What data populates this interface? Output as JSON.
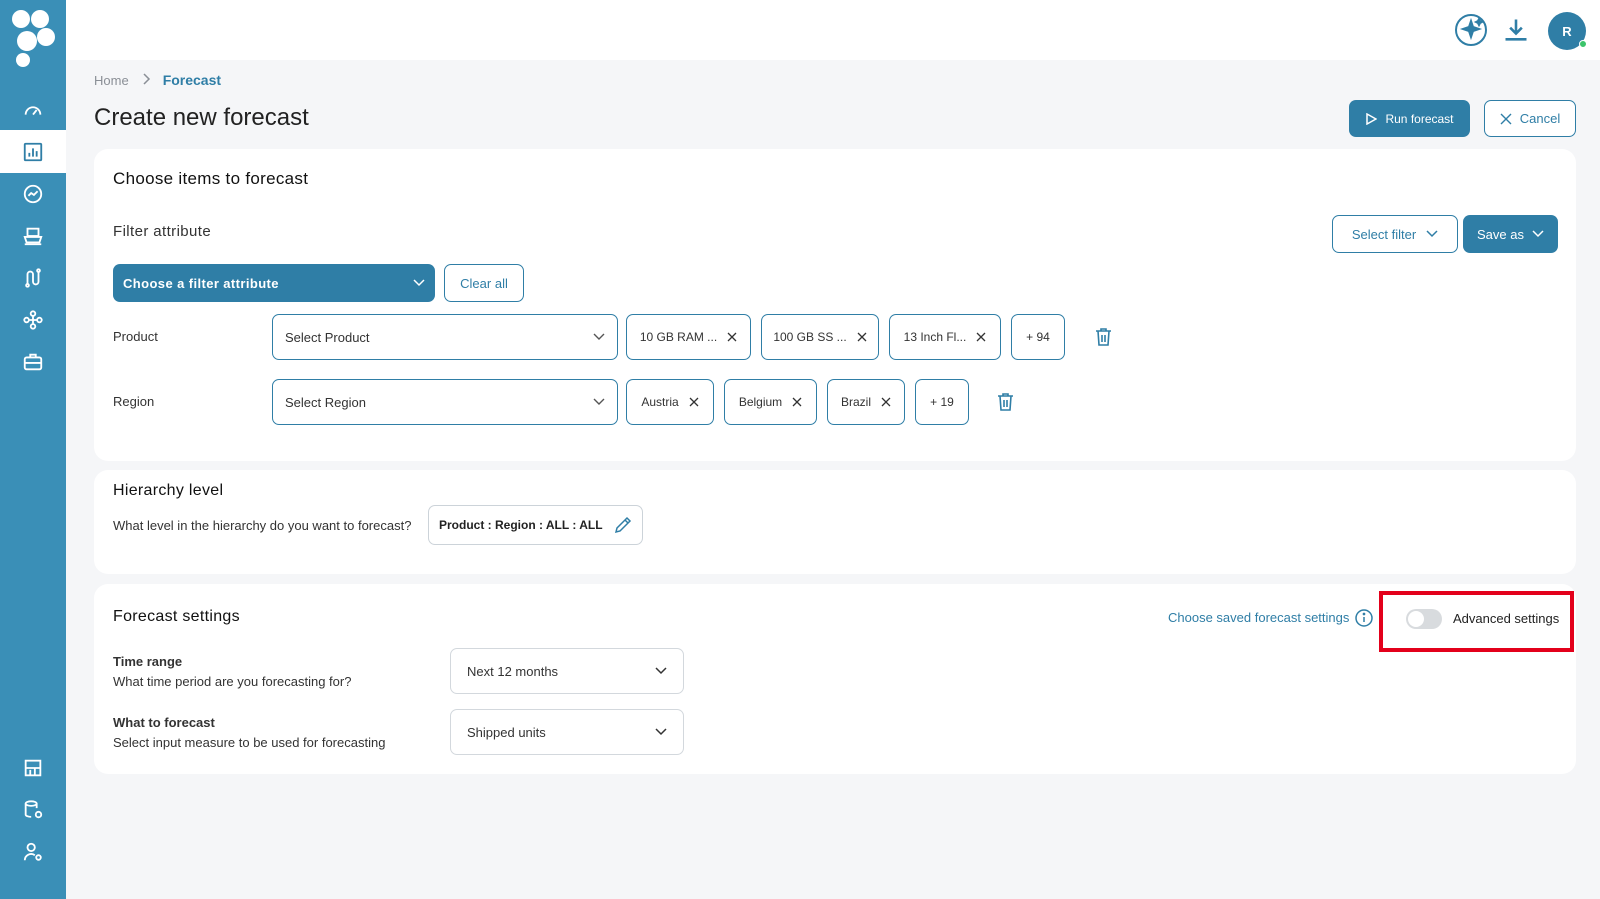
{
  "user": {
    "initial": "R"
  },
  "breadcrumb": {
    "home": "Home",
    "current": "Forecast"
  },
  "page_title": "Create new forecast",
  "actions": {
    "run": "Run forecast",
    "cancel": "Cancel"
  },
  "items_card": {
    "title": "Choose items to forecast",
    "filter_attribute_label": "Filter attribute",
    "choose_filter": "Choose a filter attribute",
    "clear_all": "Clear all",
    "select_filter": "Select filter",
    "save_as": "Save as",
    "product": {
      "label": "Product",
      "placeholder": "Select Product",
      "chips": [
        "10 GB RAM ...",
        "100 GB SS ...",
        "13 Inch Fl..."
      ],
      "more": "+ 94"
    },
    "region": {
      "label": "Region",
      "placeholder": "Select Region",
      "chips": [
        "Austria",
        "Belgium",
        "Brazil"
      ],
      "more": "+ 19"
    }
  },
  "hierarchy": {
    "title": "Hierarchy level",
    "question": "What level in the hierarchy do you want to forecast?",
    "value": "Product : Region : ALL : ALL"
  },
  "forecast_settings": {
    "title": "Forecast settings",
    "saved_link": "Choose saved forecast settings",
    "advanced_label": "Advanced settings",
    "advanced_enabled": false,
    "time_range": {
      "label": "Time range",
      "description": "What time period are you forecasting for?",
      "value": "Next 12 months"
    },
    "what_to_forecast": {
      "label": "What to forecast",
      "description": "Select input measure to be used for forecasting",
      "value": "Shipped units"
    }
  },
  "colors": {
    "primary": "#2f7ea6",
    "sidebar": "#3a8fb7",
    "highlight": "#e3001b"
  }
}
